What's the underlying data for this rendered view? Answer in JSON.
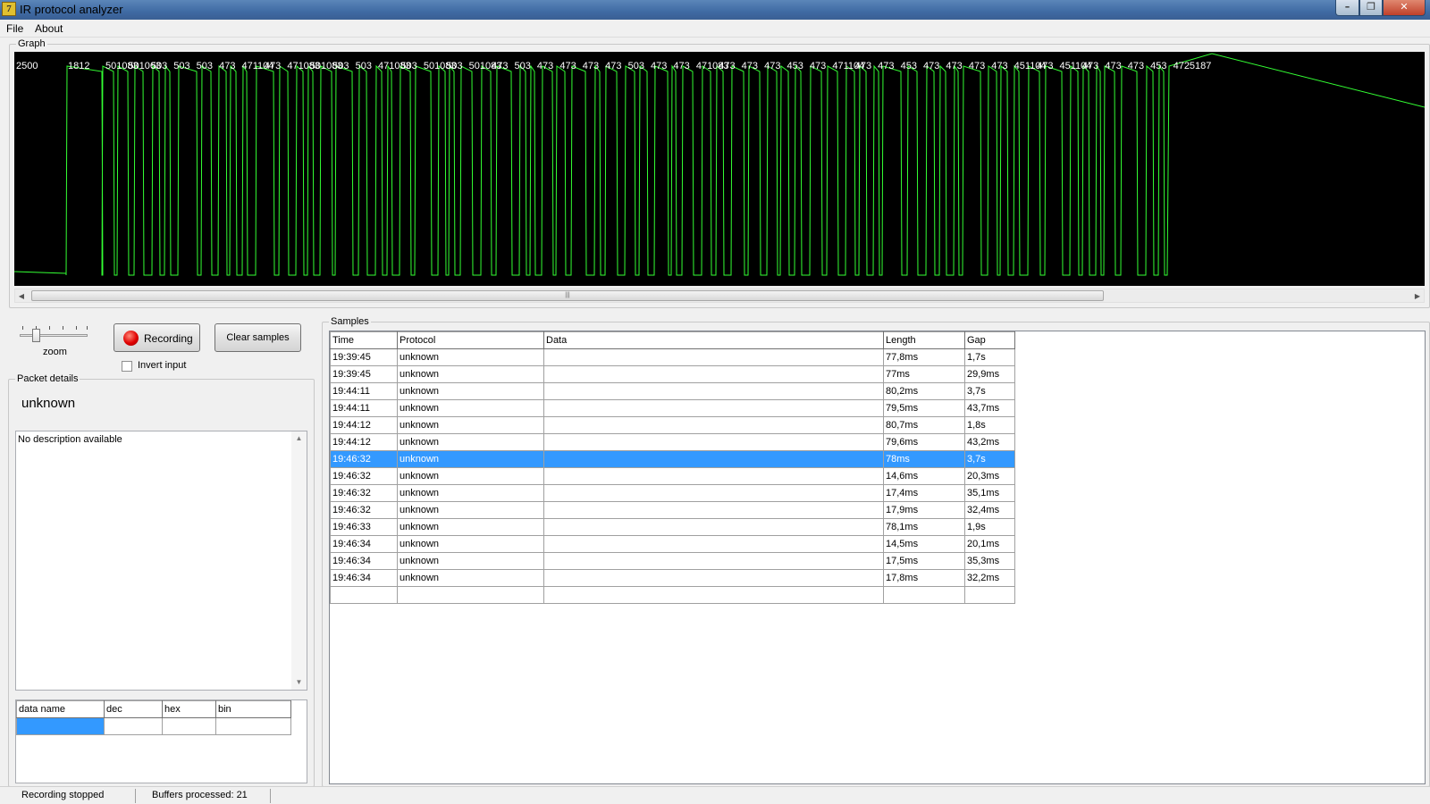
{
  "window": {
    "title": "IR protocol analyzer",
    "icon": "app-icon",
    "controls": [
      "minimize-icon",
      "maximize-icon",
      "close-icon"
    ]
  },
  "menu": {
    "items": [
      "File",
      "About"
    ]
  },
  "graph": {
    "label": "Graph",
    "pulse_labels": [
      "2500",
      "1812",
      "501083",
      "501063",
      "503",
      "503",
      "503",
      "473",
      "471104",
      "473",
      "471083",
      "501083",
      "503",
      "503",
      "471083",
      "503",
      "501083",
      "503",
      "501083",
      "473",
      "503",
      "473",
      "473",
      "473",
      "473",
      "503",
      "473",
      "473",
      "471083",
      "473",
      "473",
      "473",
      "453",
      "473",
      "471104",
      "473",
      "473",
      "453",
      "473",
      "473",
      "473",
      "473",
      "451104",
      "473",
      "451104",
      "473",
      "473",
      "473",
      "453",
      "4725187"
    ],
    "trace_color": "#33ff33",
    "label_color": "#ffffff",
    "background": "#000000"
  },
  "controls": {
    "zoom_label": "zoom",
    "record_button": "Recording",
    "clear_button": "Clear samples",
    "invert_label": "Invert input",
    "invert_checked": false
  },
  "packet": {
    "group_label": "Packet details",
    "name": "unknown",
    "description": "No description available",
    "table": {
      "columns": [
        "data name",
        "dec",
        "hex",
        "bin"
      ]
    }
  },
  "samples": {
    "group_label": "Samples",
    "columns": [
      "Time",
      "Protocol",
      "Data",
      "Length",
      "Gap"
    ],
    "selected_index": 6,
    "rows": [
      {
        "time": "19:39:45",
        "protocol": "unknown",
        "data": "",
        "length": "77,8ms",
        "gap": "1,7s"
      },
      {
        "time": "19:39:45",
        "protocol": "unknown",
        "data": "",
        "length": "77ms",
        "gap": "29,9ms"
      },
      {
        "time": "19:44:11",
        "protocol": "unknown",
        "data": "",
        "length": "80,2ms",
        "gap": "3,7s"
      },
      {
        "time": "19:44:11",
        "protocol": "unknown",
        "data": "",
        "length": "79,5ms",
        "gap": "43,7ms"
      },
      {
        "time": "19:44:12",
        "protocol": "unknown",
        "data": "",
        "length": "80,7ms",
        "gap": "1,8s"
      },
      {
        "time": "19:44:12",
        "protocol": "unknown",
        "data": "",
        "length": "79,6ms",
        "gap": "43,2ms"
      },
      {
        "time": "19:46:32",
        "protocol": "unknown",
        "data": "",
        "length": "78ms",
        "gap": "3,7s"
      },
      {
        "time": "19:46:32",
        "protocol": "unknown",
        "data": "",
        "length": "14,6ms",
        "gap": "20,3ms"
      },
      {
        "time": "19:46:32",
        "protocol": "unknown",
        "data": "",
        "length": "17,4ms",
        "gap": "35,1ms"
      },
      {
        "time": "19:46:32",
        "protocol": "unknown",
        "data": "",
        "length": "17,9ms",
        "gap": "32,4ms"
      },
      {
        "time": "19:46:33",
        "protocol": "unknown",
        "data": "",
        "length": "78,1ms",
        "gap": "1,9s"
      },
      {
        "time": "19:46:34",
        "protocol": "unknown",
        "data": "",
        "length": "14,5ms",
        "gap": "20,1ms"
      },
      {
        "time": "19:46:34",
        "protocol": "unknown",
        "data": "",
        "length": "17,5ms",
        "gap": "35,3ms"
      },
      {
        "time": "19:46:34",
        "protocol": "unknown",
        "data": "",
        "length": "17,8ms",
        "gap": "32,2ms"
      }
    ]
  },
  "status": {
    "state": "Recording stopped",
    "buffers": "Buffers processed: 21"
  }
}
